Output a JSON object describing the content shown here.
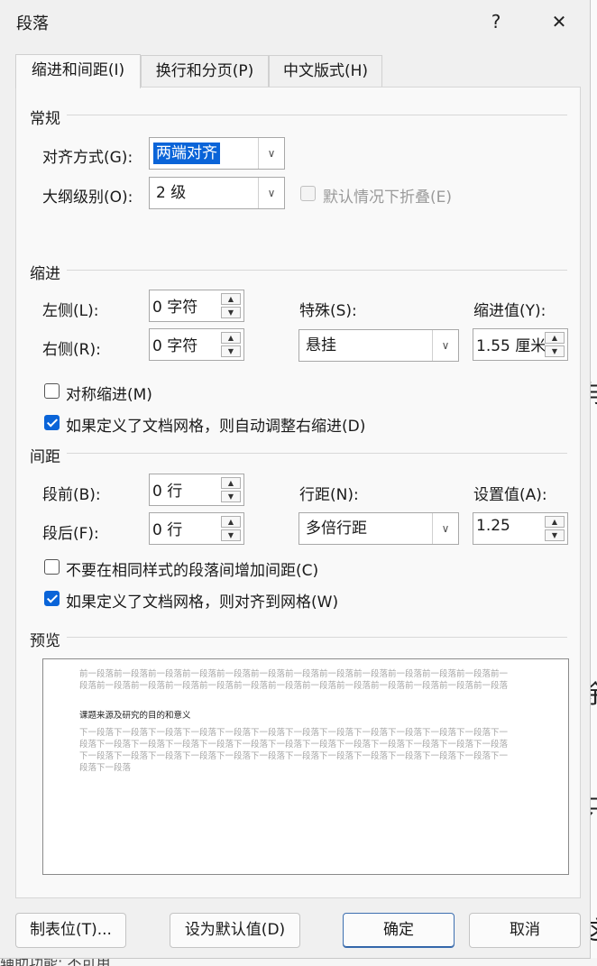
{
  "background": {
    "right_chars": [
      "与",
      "「",
      "余",
      "只",
      "这"
    ],
    "bottom_text": "辅助功能: 不可用"
  },
  "dialog": {
    "title": "段落",
    "help_label": "?",
    "close_label": "✕"
  },
  "tabs": [
    {
      "label": "缩进和间距(I)",
      "active": true
    },
    {
      "label": "换行和分页(P)",
      "active": false
    },
    {
      "label": "中文版式(H)",
      "active": false
    }
  ],
  "general": {
    "title": "常规",
    "alignment_label": "对齐方式(G):",
    "alignment_value": "两端对齐",
    "outline_label": "大纲级别(O):",
    "outline_value": "2 级",
    "collapse_label": "默认情况下折叠(E)"
  },
  "indent": {
    "title": "缩进",
    "left_label": "左侧(L):",
    "left_value": "0 字符",
    "right_label": "右侧(R):",
    "right_value": "0 字符",
    "special_label": "特殊(S):",
    "special_value": "悬挂",
    "by_label": "缩进值(Y):",
    "by_value": "1.55 厘米",
    "mirror_label": "对称缩进(M)",
    "auto_adjust_label": "如果定义了文档网格，则自动调整右缩进(D)"
  },
  "spacing": {
    "title": "间距",
    "before_label": "段前(B):",
    "before_value": "0 行",
    "after_label": "段后(F):",
    "after_value": "0 行",
    "line_label": "行距(N):",
    "line_value": "多倍行距",
    "at_label": "设置值(A):",
    "at_value": "1.25",
    "no_space_label": "不要在相同样式的段落间增加间距(C)",
    "snap_grid_label": "如果定义了文档网格，则对齐到网格(W)"
  },
  "preview": {
    "title": "预览",
    "prev_text": "前一段落前一段落前一段落前一段落前一段落前一段落前一段落前一段落前一段落前一段落前一段落前一段落前一段落前一段落前一段落前一段落前一段落前一段落前一段落前一段落前一段落前一段落前一段落前一段落前一段落",
    "current_text": "课题来源及研究的目的和意义",
    "next_text": "下一段落下一段落下一段落下一段落下一段落下一段落下一段落下一段落下一段落下一段落下一段落下一段落下一段落下一段落下一段落下一段落下一段落下一段落下一段落下一段落下一段落下一段落下一段落下一段落下一段落下一段落下一段落下一段落下一段落下一段落下一段落下一段落下一段落下一段落下一段落下一段落下一段落下一段落下一段落"
  },
  "buttons": {
    "tabs": "制表位(T)...",
    "default": "设为默认值(D)",
    "ok": "确定",
    "cancel": "取消"
  },
  "colors": {
    "accent": "#0a64d8",
    "dialog_bg": "#f0f0f0",
    "panel_bg": "#f9f9f9"
  }
}
